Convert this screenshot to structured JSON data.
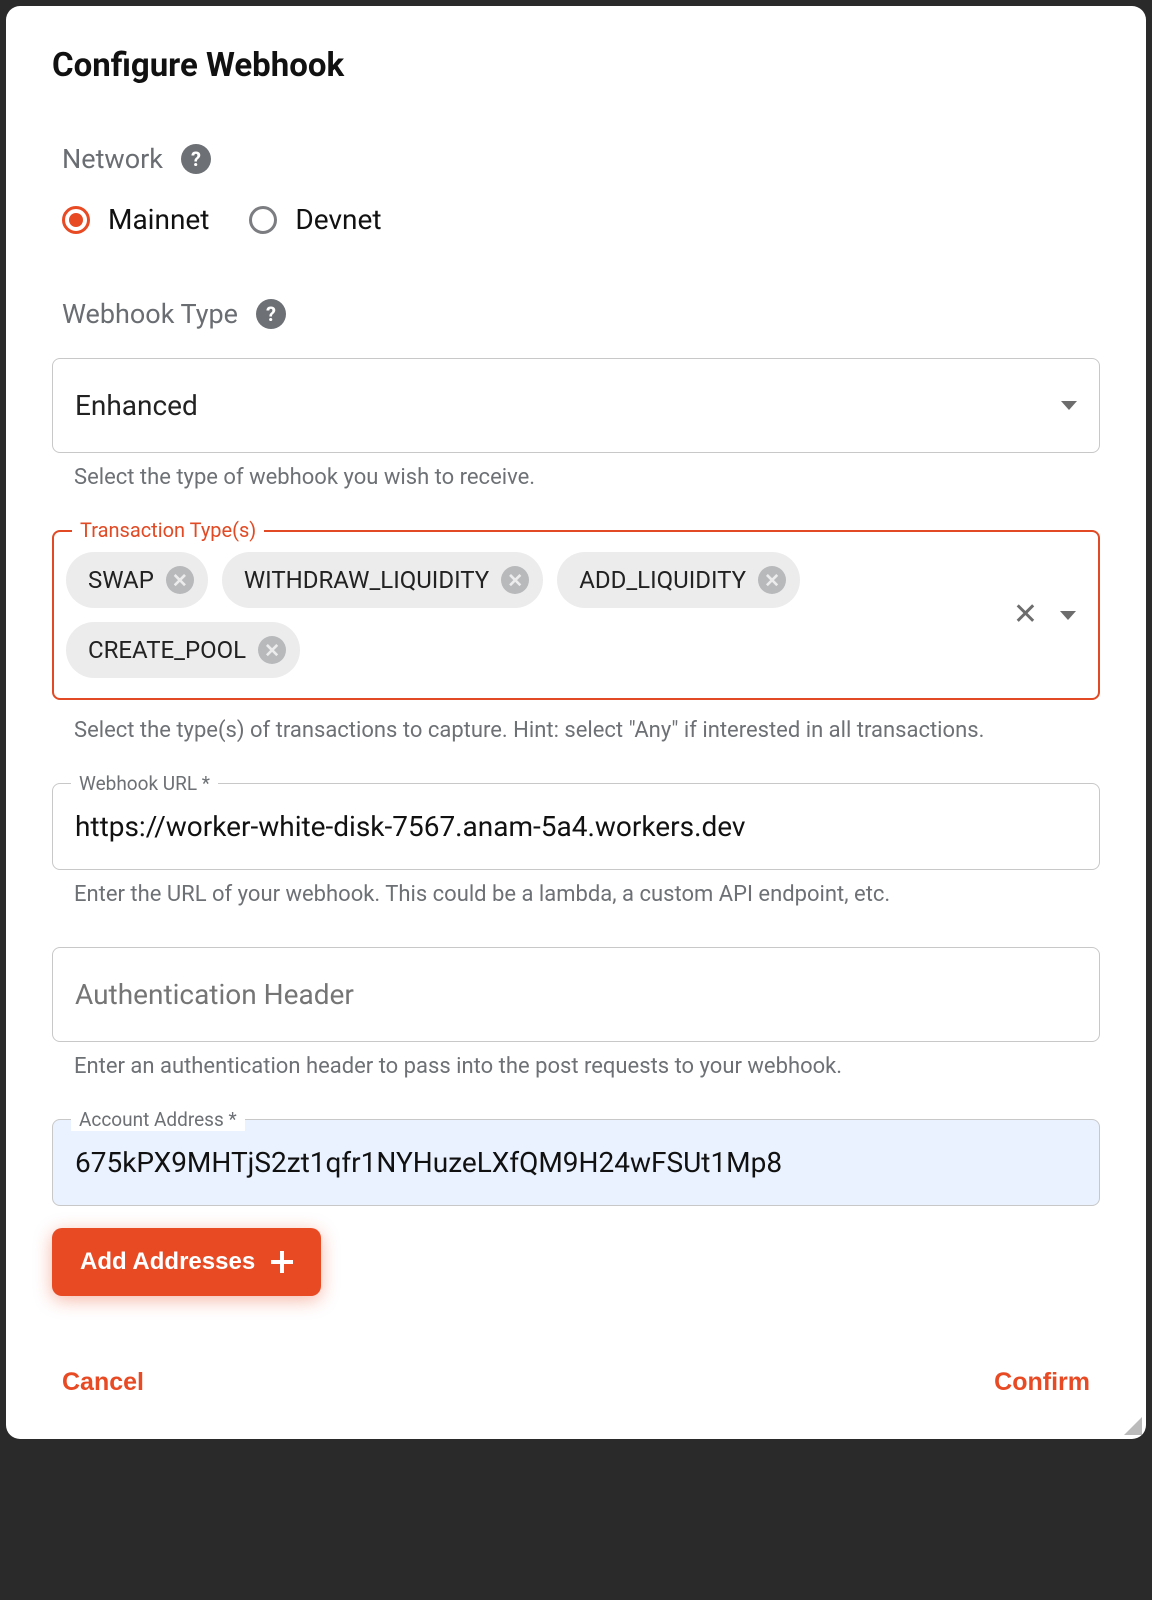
{
  "title": "Configure Webhook",
  "network": {
    "label": "Network",
    "options": [
      "Mainnet",
      "Devnet"
    ],
    "selected": "Mainnet"
  },
  "webhook_type": {
    "label": "Webhook Type",
    "value": "Enhanced",
    "helper": "Select the type of webhook you wish to receive."
  },
  "transaction_types": {
    "legend": "Transaction Type(s)",
    "chips": [
      "SWAP",
      "WITHDRAW_LIQUIDITY",
      "ADD_LIQUIDITY",
      "CREATE_POOL"
    ],
    "helper": "Select the type(s) of transactions to capture. Hint: select \"Any\" if interested in all transactions."
  },
  "webhook_url": {
    "label": "Webhook URL *",
    "value": "https://worker-white-disk-7567.anam-5a4.workers.dev",
    "helper": "Enter the URL of your webhook. This could be a lambda, a custom API endpoint, etc."
  },
  "auth_header": {
    "placeholder": "Authentication Header",
    "value": "",
    "helper": "Enter an authentication header to pass into the post requests to your webhook."
  },
  "account_address": {
    "label": "Account Address *",
    "value": "675kPX9MHTjS2zt1qfr1NYHuzeLXfQM9H24wFSUt1Mp8"
  },
  "buttons": {
    "add_addresses": "Add Addresses",
    "cancel": "Cancel",
    "confirm": "Confirm"
  }
}
